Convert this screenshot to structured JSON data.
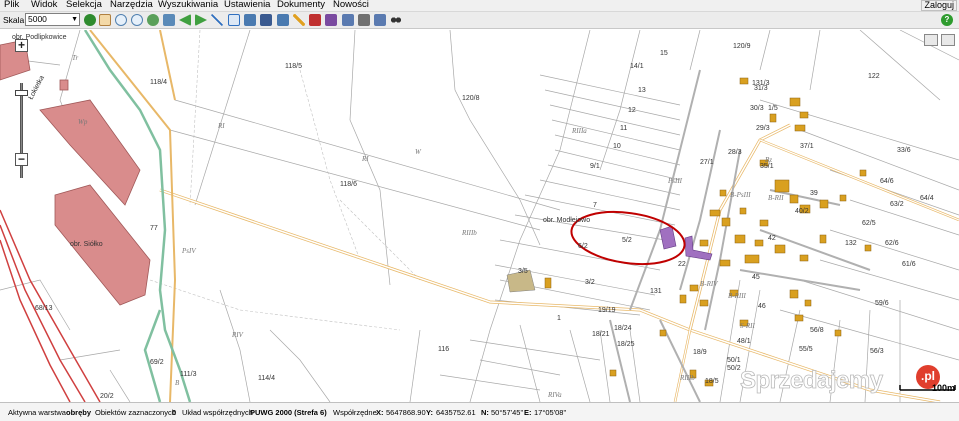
{
  "menu": [
    "Plik",
    "Widok",
    "Selekcja",
    "Narzędzia",
    "Wyszukiwania",
    "Ustawienia",
    "Dokumenty",
    "Nowości"
  ],
  "login_label": "Zaloguj",
  "toolbar": {
    "scale_label": "Skala:",
    "scale_value": "5000"
  },
  "map": {
    "parcel_labels": [
      "120/9",
      "14/1",
      "15",
      "122",
      "131/3",
      "31/3",
      "13",
      "30/3",
      "1/5",
      "12",
      "11",
      "29/3",
      "37/1",
      "10",
      "28/3",
      "33/6",
      "27/1",
      "9/1",
      "35/1",
      "64/6",
      "39",
      "63/2",
      "64/4",
      "40/2",
      "7",
      "62/5",
      "5/2",
      "42",
      "132",
      "62/6",
      "6/2",
      "22",
      "45",
      "61/6",
      "3/5",
      "3/2",
      "131",
      "46",
      "59/6",
      "19/19",
      "1",
      "18/21",
      "18/24",
      "56/8",
      "18/25",
      "48/1",
      "116",
      "55/5",
      "56/3",
      "69/2",
      "18/9",
      "50/1",
      "114/4",
      "50/2",
      "111/3",
      "20/2",
      "18/5",
      "118/5",
      "120/8",
      "118/4",
      "118/6",
      "77",
      "68/13"
    ],
    "road_labels": [
      "W",
      "RI",
      "RI",
      "RIIIb",
      "RIIIa",
      "PsIII",
      "Bz",
      "B-PsIII",
      "RIV",
      "RIVa",
      "PsIV",
      "B",
      "Wp",
      "Tr",
      "B-RII",
      "S-RII",
      "B-RIV",
      "B-RIII",
      "RIIIb"
    ],
    "place_labels": [
      "obr. Podlipkowice",
      "obr. Siółko",
      "obr. Modłejowo"
    ],
    "street_label": "Łokietka",
    "scalebar_label": "100m"
  },
  "watermark": {
    "text": "Sprzedajemy",
    "badge": ".pl"
  },
  "status": {
    "active_layer_label": "Aktywna warstwa",
    "active_layer_value": "obręby",
    "selected_label": "Obiektów zaznaczonych",
    "selected_value": "0",
    "crs_label": "Układ współrzędnych",
    "crs_value": "PUWG 2000 (Strefa 6)",
    "coords_label": "Współrzędne",
    "x_label": "X:",
    "x_value": "5647868.90",
    "y_label": "Y:",
    "y_value": "6435752.61",
    "n_label": "N:",
    "n_value": "50°57'45\"",
    "e_label": "E:",
    "e_value": "17°05'08\""
  },
  "colors": {
    "building_pink": "#d98c8c",
    "building_orange": "#d9a020",
    "highlight_purple": "#a070c0",
    "road_orange": "#e8b868",
    "railway_red": "#d04040",
    "stream_green": "#80c0a0",
    "annotation_ellipse": "#c00000",
    "parcel_line": "#9a9a9a"
  }
}
